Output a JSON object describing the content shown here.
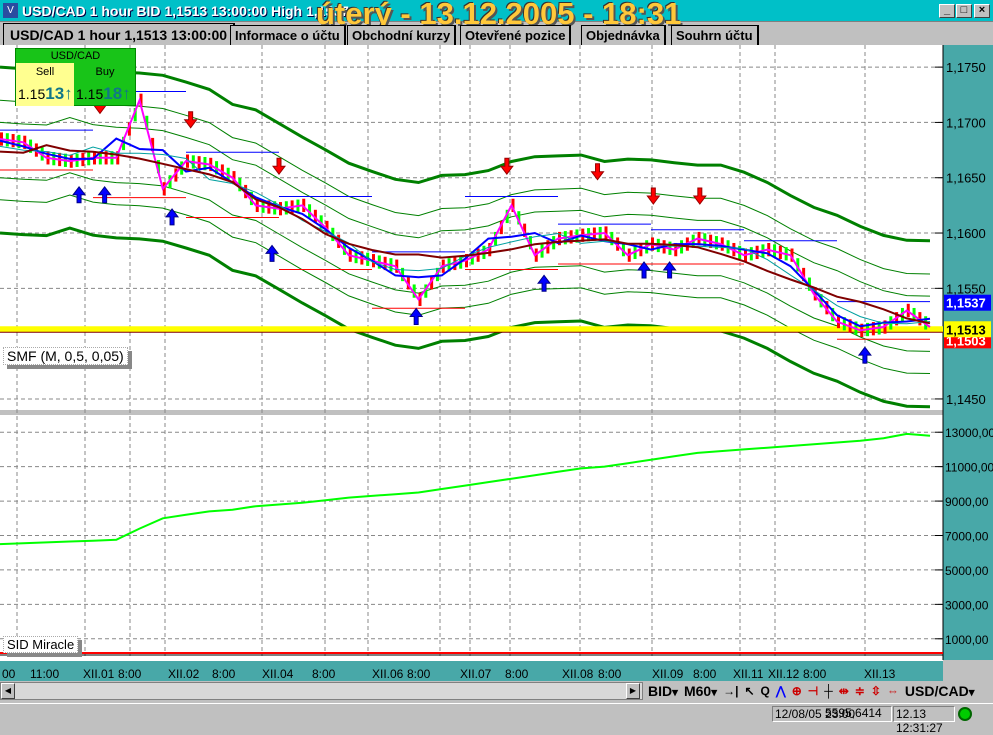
{
  "window": {
    "title": "USD/CAD 1 hour BID 1,1513 13:00:00 High 1,1537",
    "overlay_date": "úterý - 13.12.2005 - 18:31",
    "min": "_",
    "max": "□",
    "close": "×"
  },
  "tabs": [
    {
      "label": "USD/CAD 1 hour 1,1513 13:00:00"
    },
    {
      "label": "Informace o účtu"
    },
    {
      "label": "Obchodní kurzy"
    },
    {
      "label": "Otevřené pozice"
    },
    {
      "label": "Objednávka"
    },
    {
      "label": "Souhrn účtu"
    }
  ],
  "quote": {
    "pair": "USD/CAD",
    "sell_label": "Sell",
    "buy_label": "Buy",
    "sell_prefix": "1.15",
    "sell_pips": "13",
    "buy_prefix": "1.15",
    "buy_pips": "18",
    "arrow": "↑"
  },
  "indicators": {
    "upper": "SMF (M, 0,5, 0,05)",
    "lower": "SID Miracle"
  },
  "price_axis": {
    "ticks": [
      "1,1750",
      "1,1700",
      "1,1650",
      "1,1600",
      "1,1550",
      "1,1450"
    ],
    "high_tag": "1,1537",
    "current_tag": "1,1513",
    "low_tag": "1,1503"
  },
  "equity_axis": {
    "ticks": [
      "13000,00",
      "11000,00",
      "9000,00",
      "7000,00",
      "5000,00",
      "3000,00",
      "1000,00"
    ]
  },
  "time_axis": [
    "00",
    "11:00",
    "XII.01",
    "8:00",
    "XII.02",
    "8:00",
    "XII.04",
    "8:00",
    "XII.06",
    "8:00",
    "XII.07",
    "8:00",
    "XII.08",
    "8:00",
    "XII.09",
    "8:00",
    "XII.11",
    "XII.12",
    "8:00",
    "XII.13"
  ],
  "toolbar": {
    "price_type": "BID",
    "timeframe": "M60",
    "symbol": "USD/CAD",
    "dropdown": "▾",
    "tools": [
      "→|",
      "↖",
      "Q",
      "⋀",
      "⊕",
      "⊣",
      "┼",
      "⇹",
      "≑",
      "⇳",
      "⇔"
    ]
  },
  "status": {
    "bar_time": "12/08/05 23:00",
    "value": "5595,6414",
    "clock": "12.13 12:31:27"
  },
  "colors": {
    "band": "#008000",
    "price": "#ff00ff",
    "ma_fast": "#0000ff",
    "ma_slow": "#800000",
    "equity": "#00ff00",
    "current": "#ffff00"
  },
  "chart_data": {
    "type": "line",
    "price_range": [
      1.144,
      1.177
    ],
    "price_close": [
      1.1685,
      1.1682,
      1.1668,
      1.1665,
      1.1668,
      1.1668,
      1.172,
      1.164,
      1.1665,
      1.1662,
      1.165,
      1.1625,
      1.1622,
      1.1625,
      1.1605,
      1.158,
      1.1575,
      1.157,
      1.154,
      1.157,
      1.1575,
      1.1585,
      1.1625,
      1.158,
      1.1595,
      1.1598,
      1.16,
      1.158,
      1.159,
      1.1585,
      1.1595,
      1.159,
      1.158,
      1.1585,
      1.158,
      1.1545,
      1.152,
      1.1512,
      1.1515,
      1.153,
      1.1515
    ],
    "current": 1.1513,
    "high": 1.1537,
    "low": 1.1503,
    "sell_arrows": [
      [
        4.3,
        1.171
      ],
      [
        8.2,
        1.1697
      ],
      [
        12,
        1.1655
      ],
      [
        21.8,
        1.1655
      ],
      [
        25.7,
        1.165
      ],
      [
        28.1,
        1.1628
      ],
      [
        30.1,
        1.1628
      ]
    ],
    "buy_arrows": [
      [
        3.4,
        1.164
      ],
      [
        4.5,
        1.164
      ],
      [
        7.4,
        1.162
      ],
      [
        11.7,
        1.1587
      ],
      [
        17.9,
        1.153
      ],
      [
        23.4,
        1.156
      ],
      [
        27.7,
        1.1572
      ],
      [
        28.8,
        1.1572
      ],
      [
        37.2,
        1.1495
      ]
    ],
    "equity_range": [
      0,
      14000
    ],
    "equity": [
      6500,
      6550,
      6600,
      6650,
      6700,
      6750,
      7400,
      8000,
      8200,
      8400,
      8500,
      8700,
      8800,
      8900,
      9050,
      9200,
      9300,
      9400,
      9500,
      9700,
      9900,
      10100,
      10300,
      10500,
      10700,
      10900,
      11000,
      11200,
      11400,
      11600,
      11800,
      11900,
      12000,
      12100,
      12200,
      12300,
      12400,
      12500,
      12650,
      12900,
      12800
    ]
  }
}
